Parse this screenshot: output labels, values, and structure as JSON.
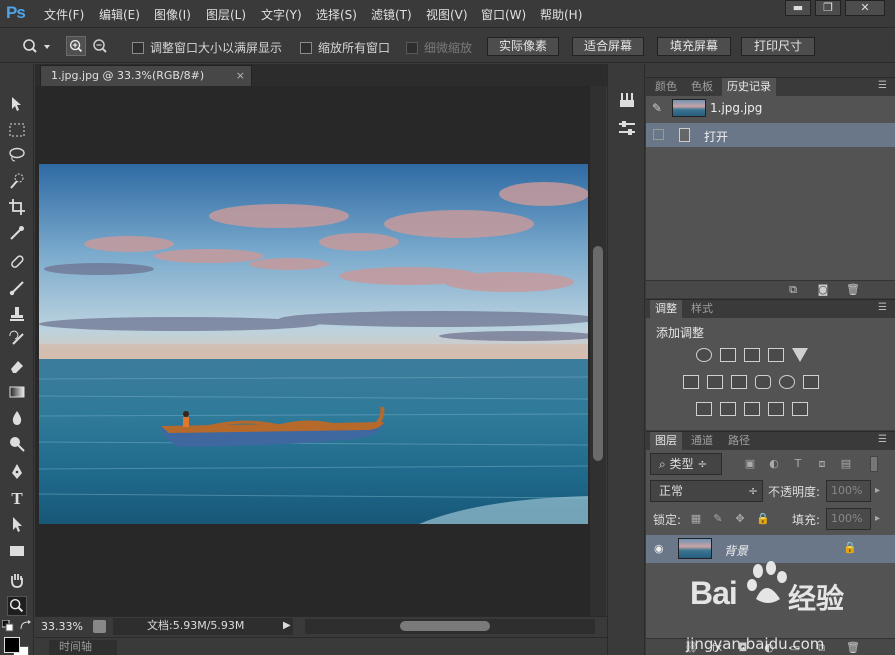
{
  "app": {
    "logo": "Ps"
  },
  "menu": [
    "文件(F)",
    "编辑(E)",
    "图像(I)",
    "图层(L)",
    "文字(Y)",
    "选择(S)",
    "滤镜(T)",
    "视图(V)",
    "窗口(W)",
    "帮助(H)"
  ],
  "window_buttons": {
    "minimize": "▬",
    "restore": "❐",
    "close": "✕"
  },
  "options": {
    "resize_windows_label": "调整窗口大小以满屏显示",
    "zoom_all_label": "缩放所有窗口",
    "scrubby_label": "细微缩放",
    "actual_pixels": "实际像素",
    "fit_screen": "适合屏幕",
    "fill_screen": "填充屏幕",
    "print_size": "打印尺寸"
  },
  "document": {
    "tab_title": "1.jpg.jpg @ 33.3%(RGB/8#)",
    "tab_close": "×",
    "zoom": "33.33%",
    "doc_info": "文档:5.93M/5.93M",
    "status_arrow": "▶",
    "timeline_tab": "时间轴"
  },
  "history_panel": {
    "tabs": [
      "颜色",
      "色板",
      "历史记录"
    ],
    "active_tab": 2,
    "snapshot_label": "1.jpg.jpg",
    "state_label": "打开"
  },
  "adjust_panel": {
    "tabs": [
      "调整",
      "样式"
    ],
    "title": "添加调整"
  },
  "layers_panel": {
    "tabs": [
      "图层",
      "通道",
      "路径"
    ],
    "filter_kind": "类型",
    "blend_mode": "正常",
    "opacity_label": "不透明度:",
    "opacity_value": "100%",
    "lock_label": "锁定:",
    "fill_label": "填充:",
    "fill_value": "100%",
    "layer_name": "背景"
  },
  "watermark": {
    "brand": "Bai",
    "brand_cn": "经验",
    "url": "jingyan.baidu.com"
  },
  "colors": {
    "accent": "#4fa3e6",
    "selection": "#6a7789",
    "panel": "#535353",
    "chrome": "#3a3a3a"
  }
}
